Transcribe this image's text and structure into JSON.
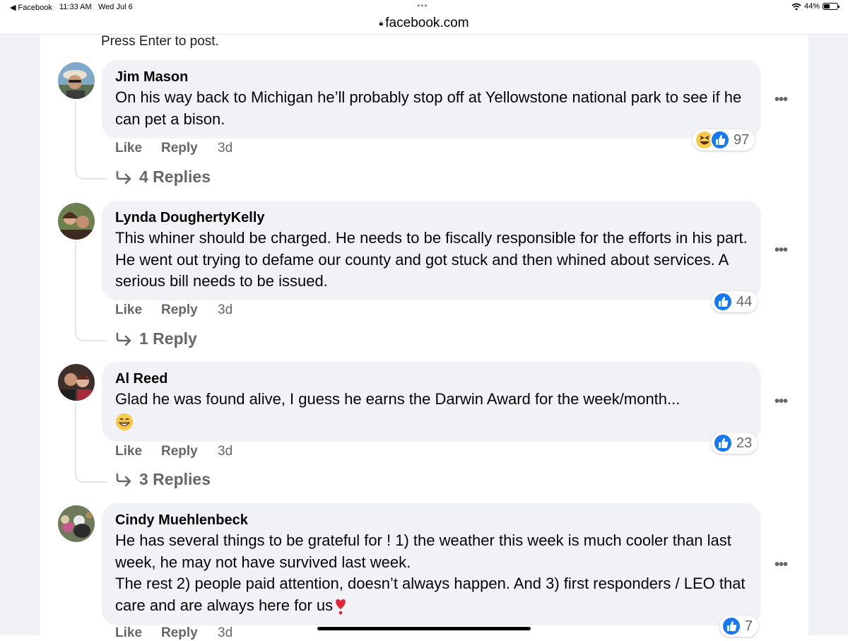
{
  "status_bar": {
    "back_app": "◀ Facebook",
    "time": "11:33 AM",
    "date": "Wed Jul 6",
    "dots": "•••",
    "wifi": "wifi-icon",
    "battery": "44%",
    "battery_level": 0.44
  },
  "url_bar": {
    "url": "facebook.com",
    "lock_icon": "lock-icon"
  },
  "composer_hint": "Press Enter to post.",
  "comments": [
    {
      "author": "Jim Mason",
      "text": "On his way back to Michigan he’ll probably stop off at Yellowstone national park to see if he can pet a bison.",
      "like": "Like",
      "reply": "Reply",
      "time": "3d",
      "replies": "4 Replies",
      "reaction_count": "97",
      "reactions": [
        "haha-reaction-icon",
        "like-reaction-icon"
      ],
      "more": "•••"
    },
    {
      "author": "Lynda DoughertyKelly",
      "text": "This whiner should be charged. He needs to be fiscally responsible for the efforts in his part. He went out trying to defame our county and got stuck and then whined about services. A serious bill needs to be issued.",
      "like": "Like",
      "reply": "Reply",
      "time": "3d",
      "replies": "1 Reply",
      "reaction_count": "44",
      "reactions": [
        "like-reaction-icon"
      ],
      "more": "•••"
    },
    {
      "author": "Al Reed",
      "text": "Glad he was found alive, I guess he earns the Darwin Award for the week/month...",
      "emoji": "grinning-face-emoji",
      "like": "Like",
      "reply": "Reply",
      "time": "3d",
      "replies": "3 Replies",
      "reaction_count": "23",
      "reactions": [
        "like-reaction-icon"
      ],
      "more": "•••"
    },
    {
      "author": "Cindy Muehlenbeck",
      "text_lines": [
        "He has several things to be grateful for ! 1) the weather this week is much cooler than last week, he may not have survived last week.",
        "The rest 2) people paid attention, doesn’t always happen. And 3) first responders / LEO that care and are always here for us"
      ],
      "emoji": "heart-exclamation-emoji",
      "like": "Like",
      "reply": "Reply",
      "time": "3d",
      "reaction_count": "7",
      "reactions": [
        "like-reaction-icon"
      ],
      "more": "•••"
    }
  ]
}
